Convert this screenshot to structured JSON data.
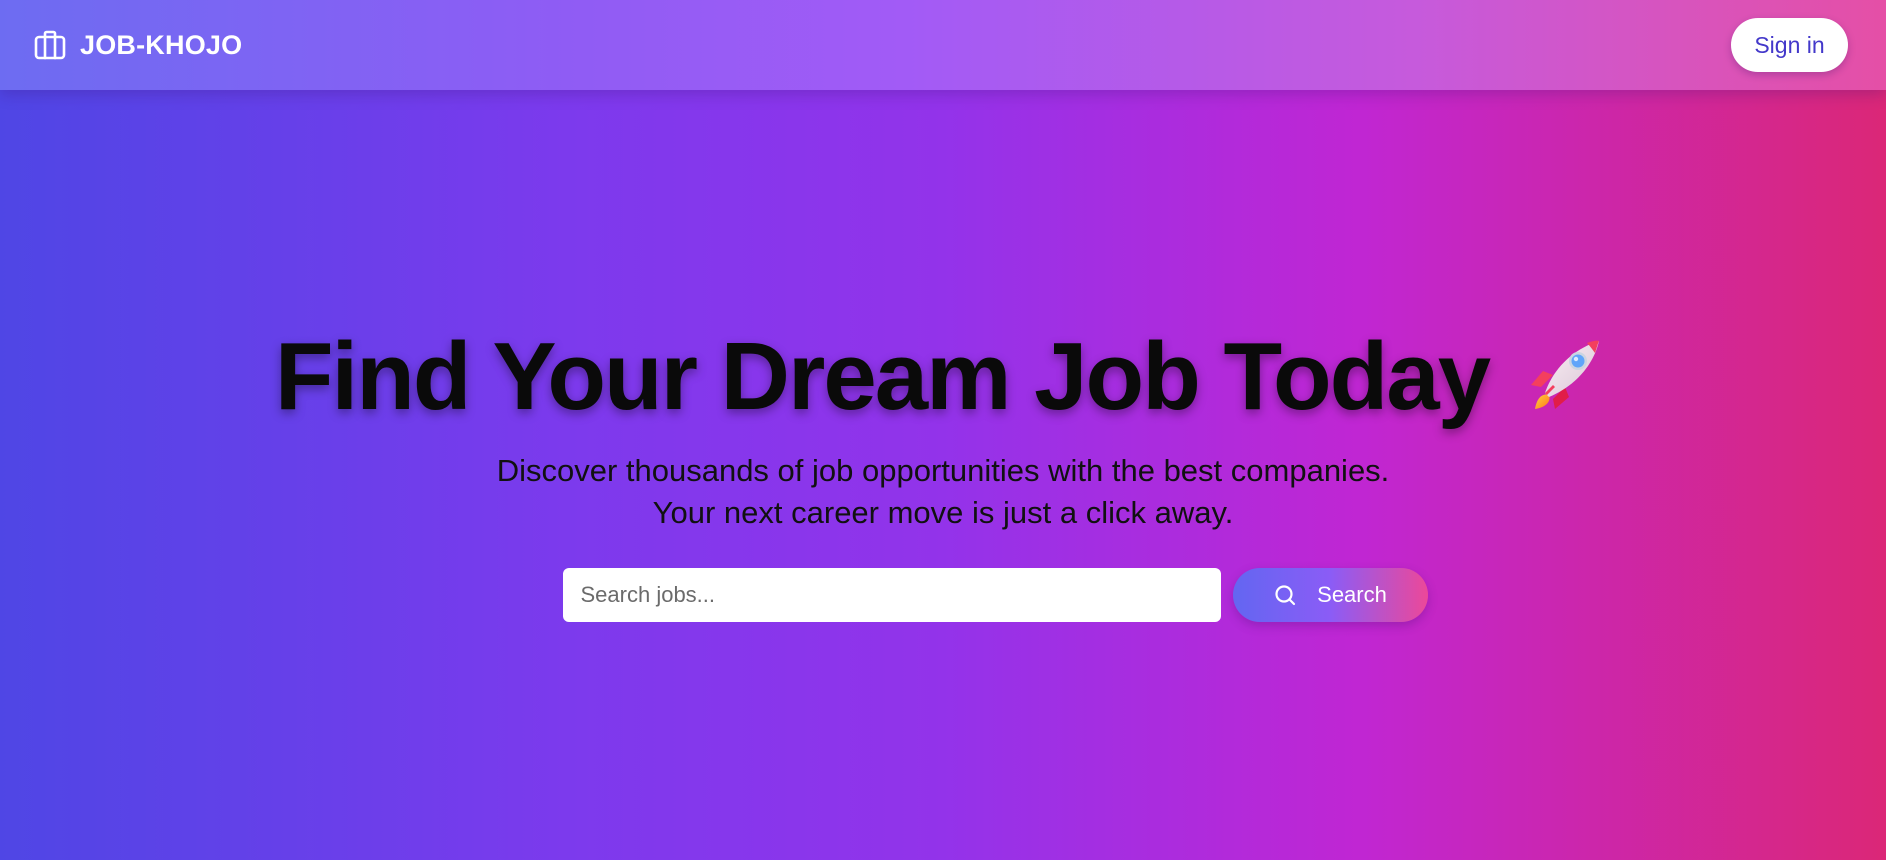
{
  "nav": {
    "brand_icon": "briefcase-icon",
    "brand_name": "JOB-KHOJO",
    "signin_label": "Sign in"
  },
  "hero": {
    "headline": "Find Your Dream Job Today",
    "headline_icon": "rocket-icon",
    "subtitle_line1": "Discover thousands of job opportunities with the best companies.",
    "subtitle_line2": "Your next career move is just a click away."
  },
  "search": {
    "placeholder": "Search jobs...",
    "value": "",
    "button_label": "Search",
    "button_icon": "search-icon"
  },
  "colors": {
    "accent_text": "#4338ca",
    "gradient_start": "#4f46e5",
    "gradient_mid": "#9333ea",
    "gradient_end": "#db2777"
  }
}
